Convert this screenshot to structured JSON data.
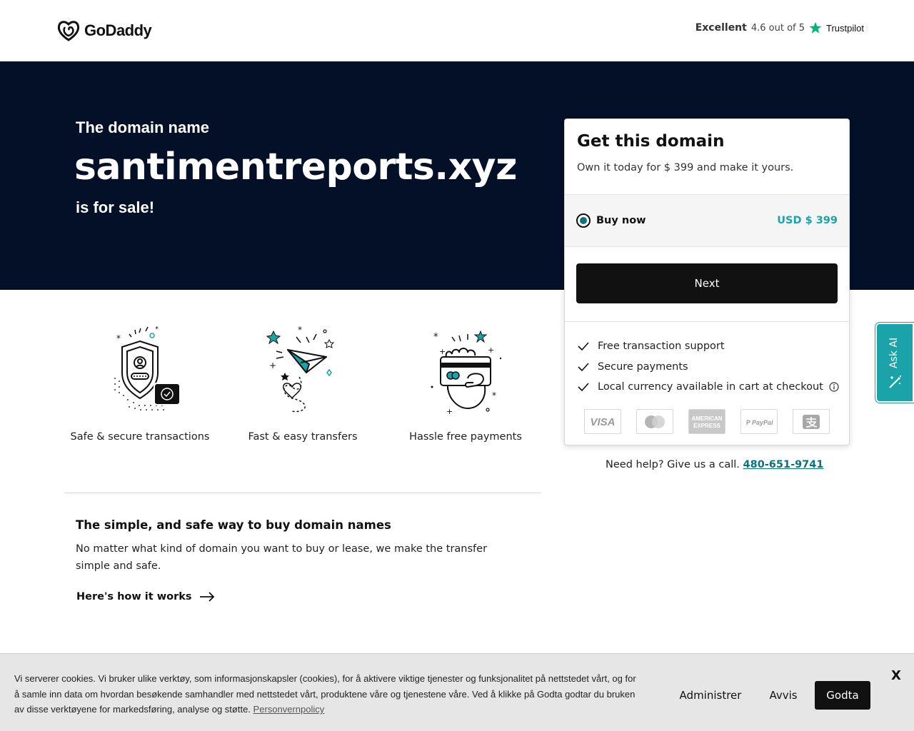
{
  "header": {
    "logo_text": "GoDaddy",
    "trust_rating": "Excellent",
    "trust_score": "4.6 out of 5",
    "trust_brand": "Trustpilot"
  },
  "hero": {
    "pre": "The domain name",
    "domain": "santimentreports.xyz",
    "post": "is for sale!"
  },
  "features": [
    {
      "label": "Safe & secure transactions",
      "icon": "shield-user-icon"
    },
    {
      "label": "Fast & easy transfers",
      "icon": "paper-plane-icon"
    },
    {
      "label": "Hassle free payments",
      "icon": "hand-card-icon"
    }
  ],
  "info": {
    "title": "The simple, and safe way to buy domain names",
    "text": "No matter what kind of domain you want to buy or lease, we make the transfer simple and safe.",
    "link": "Here's how it works"
  },
  "card": {
    "title": "Get this domain",
    "subtitle": "Own it today for $ 399 and make it yours.",
    "option_label": "Buy now",
    "option_price": "USD $ 399",
    "next": "Next",
    "features": [
      "Free transaction support",
      "Secure payments",
      "Local currency available in cart at checkout"
    ],
    "payments": [
      "VISA",
      "Mastercard",
      "American Express",
      "PayPal",
      "Alipay"
    ]
  },
  "help": {
    "text": "Need help? Give us a call.",
    "phone": "480-651-9741"
  },
  "ask_ai": {
    "label": "Ask AI"
  },
  "cookie": {
    "text": "Vi serverer cookies. Vi bruker ulike verktøy, som informasjonskapsler (cookies), for å aktivere viktige tjenester og funksjonalitet på nettstedet vårt, og for å samle inn data om hvordan besøkende samhandler med nettstedet vårt, produktene våre og tjenestene våre. Ved å klikke på Godta godtar du bruken av disse verktøyene for markedsføring, analyse og støtte.",
    "policy": "Personvernpolicy",
    "admin": "Administrer",
    "reject": "Avvis",
    "accept": "Godta",
    "close": "X"
  },
  "colors": {
    "hero_bg": "#031028",
    "teal": "#1aa3a8",
    "link_teal": "#09757a",
    "button_black": "#111111"
  }
}
